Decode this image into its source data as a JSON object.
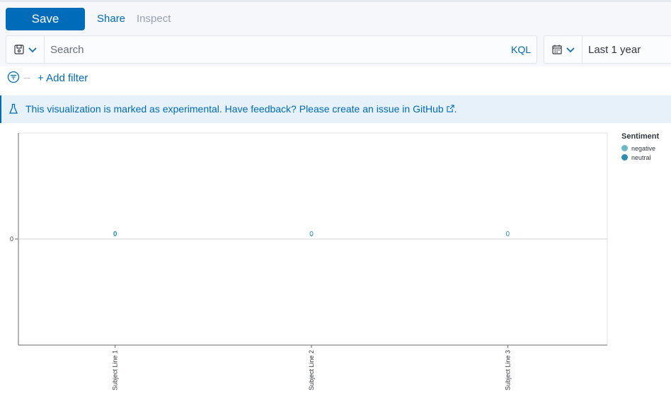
{
  "toolbar": {
    "save_label": "Save",
    "share_label": "Share",
    "inspect_label": "Inspect"
  },
  "query": {
    "placeholder": "Search",
    "language": "KQL",
    "saved_query_icon": "save-icon",
    "time_range": "Last 1 year",
    "calendar_icon": "calendar-icon"
  },
  "filters": {
    "add_label": "+ Add filter",
    "icon": "filter-icon"
  },
  "callout": {
    "text": "This visualization is marked as experimental. Have feedback? Please create an issue in",
    "link": "GitHub",
    "suffix": ".",
    "icon": "beaker-icon"
  },
  "colors": {
    "primary": "#006bb8",
    "negative": "#6cb8c9",
    "neutral": "#2b8db0"
  },
  "chart_data": {
    "type": "bar",
    "categories": [
      "Subject Line 1",
      "Subject Line 2",
      "Subject Line 3"
    ],
    "series": [
      {
        "name": "negative",
        "values": [
          0,
          0,
          0
        ]
      },
      {
        "name": "neutral",
        "values": [
          0,
          0,
          0
        ]
      }
    ],
    "data_labels": [
      "0",
      "0",
      "0"
    ],
    "y_ticks": [
      "0"
    ],
    "legend_title": "Sentiment",
    "legend_position": "right",
    "ylim": [
      -1,
      1
    ]
  }
}
